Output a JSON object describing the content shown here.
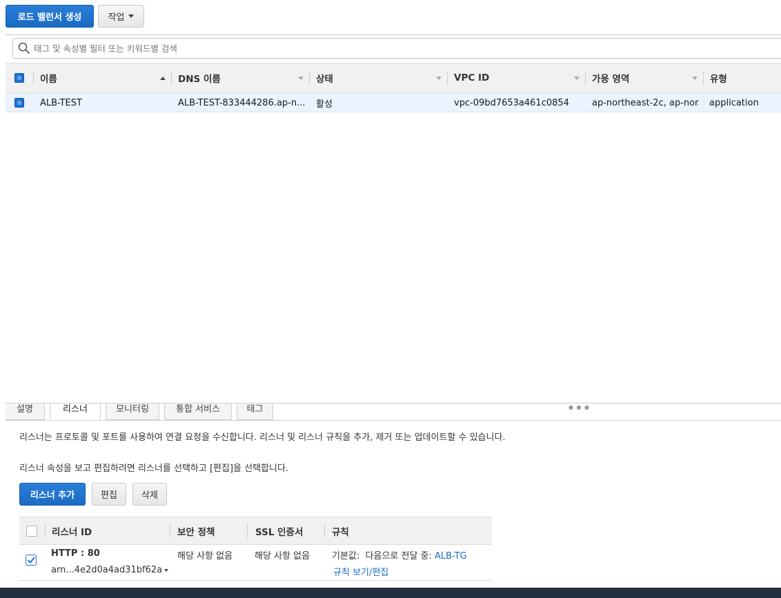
{
  "toolbar": {
    "create_label": "로드 밸런서 생성",
    "actions_label": "작업"
  },
  "search": {
    "placeholder": "태그 및 속성별 필터 또는 키워드별 검색"
  },
  "table": {
    "columns": [
      "이름",
      "DNS 이름",
      "상태",
      "VPC ID",
      "가용 영역",
      "유형"
    ],
    "rows": [
      {
        "name": "ALB-TEST",
        "dns": "ALB-TEST-833444286.ap-n...",
        "state": "활성",
        "vpc": "vpc-09bd7653a461c0854",
        "az": "ap-northeast-2c, ap-nor...",
        "type": "application"
      }
    ]
  },
  "tabs": [
    "설명",
    "리스너",
    "모니터링",
    "통합 서비스",
    "태그"
  ],
  "detail": {
    "description": "리스너는 프로토콜 및 포트를 사용하여 연결 요청을 수신합니다. 리스너 및 리스너 규칙을 추가, 제거 또는 업데이트할 수 있습니다.",
    "hint": "리스너 속성을 보고 편집하려면 리스너를 선택하고 [편집]을 선택합니다.",
    "add_label": "리스너 추가",
    "edit_label": "편집",
    "delete_label": "삭제"
  },
  "listeners": {
    "columns": [
      "리스너 ID",
      "보안 정책",
      "SSL 인증서",
      "규칙"
    ],
    "rows": [
      {
        "id": "HTTP : 80",
        "arn": "arn...4e2d0a4ad31bf62a",
        "security_policy": "해당 사항 없음",
        "ssl_cert": "해당 사항 없음",
        "rule_prefix": "기본값:  다음으로 전달 중:",
        "rule_target": "ALB-TG",
        "rule_link": "규칙 보기/편집"
      }
    ]
  }
}
